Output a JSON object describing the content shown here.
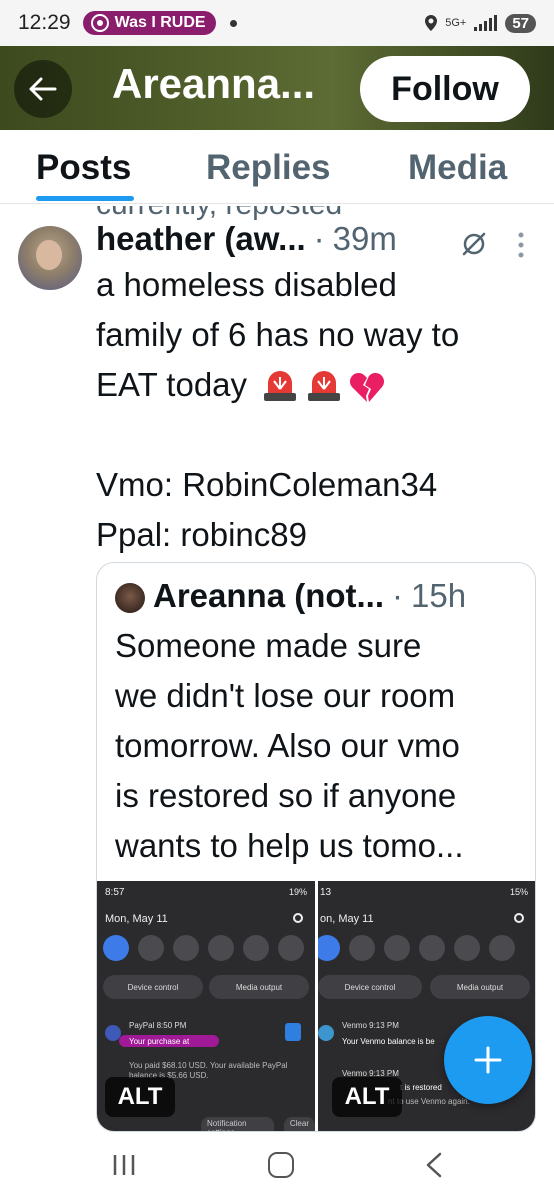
{
  "status_bar": {
    "time": "12:29",
    "notification_pill": "Was I RUDE",
    "network": "5G+",
    "battery": "57"
  },
  "header": {
    "title": "Areanna...",
    "follow_label": "Follow"
  },
  "tabs": [
    {
      "label": "Posts",
      "active": true
    },
    {
      "label": "Replies",
      "active": false
    },
    {
      "label": "Media",
      "active": false
    }
  ],
  "truncated_prev_line": "currently, reposted",
  "post": {
    "author": "heather (aw...",
    "separator": "·",
    "age": "39m",
    "lines": [
      "a homeless disabled",
      "family of 6 has no way to",
      "EAT today",
      "",
      "Vmo: RobinColeman34",
      "Ppal: robinc89"
    ],
    "emoji_after_line_3": [
      "siren-emoji",
      "siren-emoji",
      "broken-heart-emoji"
    ]
  },
  "quote": {
    "author": "Areanna (not...",
    "separator": "·",
    "age": "15h",
    "lines": [
      "Someone made sure",
      "we didn't lose our room",
      "tomorrow. Also our vmo",
      "is restored so if anyone",
      "wants to help us tomo..."
    ],
    "images": [
      {
        "time": "8:57",
        "status": "19%",
        "date": "Mon, May 11",
        "btn_left": "Device control",
        "btn_right": "Media output",
        "app": "PayPal 8:50 PM",
        "title": "Your purchase at",
        "text": "You paid $68.10 USD. Your available PayPal balance is $5.66 USD.",
        "footer_left": "Notification settings",
        "footer_right": "Clear",
        "alt": "ALT"
      },
      {
        "time": "13",
        "status": "15%",
        "date": "on, May 11",
        "btn_left": "Device control",
        "btn_right": "Media output",
        "app": "Venmo 9:13 PM",
        "title": "Your Venmo balance is be",
        "app2": "Venmo 9:13 PM",
        "text2a": "t is restored",
        "text2b": "nt to use Venmo again.",
        "alt": "ALT"
      }
    ]
  },
  "fab": {
    "icon": "plus-icon",
    "color": "#1d9bf0"
  },
  "nav": {
    "items": [
      "recent-apps-icon",
      "home-icon",
      "back-icon"
    ]
  }
}
